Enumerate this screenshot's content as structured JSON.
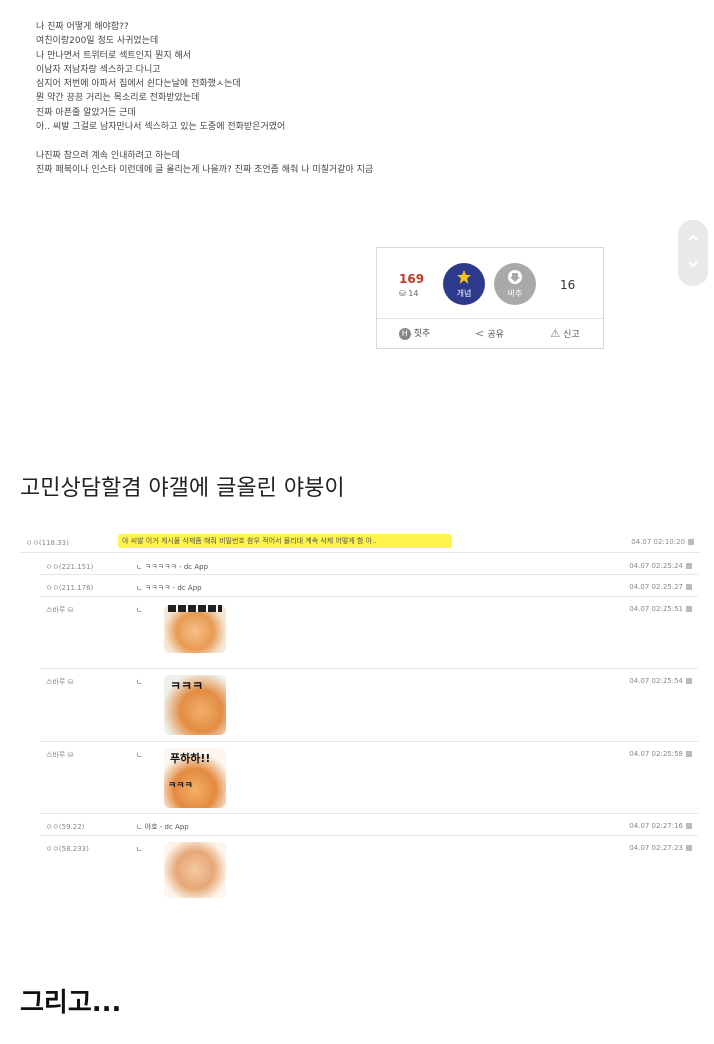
{
  "post": {
    "lines": [
      "나 진짜 어떻게 해야함??",
      "여친이랑200일 정도 사귀었는데",
      "나 만나면서 트위터로 섹트인지 뭔지 해서",
      "이남자 저남자랑 섹스하고 다니고",
      "심지어 저번에 아파서 집에서 쉰다는날에 전화했ㅅ는데",
      "뭔 약간 끙끙 거리는 목소리로 전화받았는데",
      "진짜 아픈줄 알았거든 근데",
      "아.. 씨발 그걸로 남자만나서 섹스하고 있는 도중에 전화받은거였어",
      "",
      "나진짜 참으려 계속 인내하려고 하는데",
      "진짜 페북이나 인스타 이런데에 글 올리는게 나을까? 진짜 조언좀 해줘 나 미칠거같아 지금"
    ]
  },
  "scroll": {
    "up_icon": "chevron-up-icon",
    "down_icon": "chevron-down-icon"
  },
  "recommend": {
    "up_count": "169",
    "fixed_count": "14",
    "up_label": "개념",
    "down_label": "비추",
    "down_count": "16",
    "hit_label": "힛추",
    "share_label": "공유",
    "report_label": "신고"
  },
  "heading1": "고민상담할겸 야갤에 글올린 야붕이",
  "comments": {
    "first": {
      "name": "ㅇㅇ(118.33)",
      "text": "야 씨발 이거 게시물 삭제좀 해줘 비밀번호 참우 적어서 몰리대 계속 삭제 어떻게 함 아..",
      "date": "04.07 02:10:20"
    },
    "rows": [
      {
        "name": "ㅇㅇ(221.151)",
        "text": "ㄴ ㅋㅋㅋㅋㅋ - dc App",
        "date": "04.07 02:25:24"
      },
      {
        "name": "ㅇㅇ(211.176)",
        "text": "ㄴ ㅋㅋㅋㅋ - dc App",
        "date": "04.07 02:25:27"
      },
      {
        "name": "스바루",
        "text": "ㄴ",
        "date": "04.07 02:25:51"
      },
      {
        "name": "스바루",
        "text": "ㄴ",
        "date": "04.07 02:25:54"
      },
      {
        "name": "스바루",
        "text": "ㄴ",
        "date": "04.07 02:25:58"
      },
      {
        "name": "ㅇㅇ(59.22)",
        "text": "ㄴ 야호 - dc App",
        "date": "04.07 02:27:16"
      },
      {
        "name": "ㅇㅇ(58.233)",
        "text": "ㄴ",
        "date": "04.07 02:27:23"
      }
    ],
    "sticker_texts": {
      "s2": "ㅋㅋㅋ",
      "s3a": "푸하하!!",
      "s3b": "ㅋㅋㅋ"
    }
  },
  "heading2": "그리고..."
}
